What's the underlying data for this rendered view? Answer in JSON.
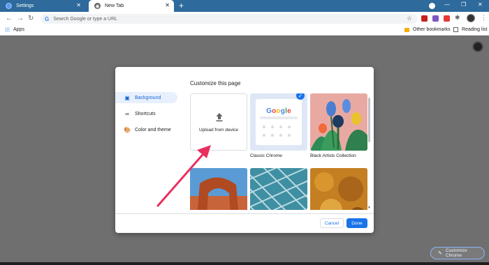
{
  "tabs": [
    {
      "label": "Settings",
      "icon": "gear-icon"
    },
    {
      "label": "New Tab",
      "icon": "chrome-icon"
    }
  ],
  "new_tab_button": "+",
  "window_controls": [
    "—",
    "❐",
    "✕"
  ],
  "omnibox": {
    "placeholder": "Search Google or type a URL",
    "icon": "G"
  },
  "bookmarks_bar": {
    "apps": "Apps",
    "other_bookmarks": "Other bookmarks",
    "reading_list": "Reading list"
  },
  "dialog": {
    "title": "Customize this page",
    "sidebar": [
      {
        "label": "Background",
        "icon": "image-icon",
        "active": true
      },
      {
        "label": "Shortcuts",
        "icon": "link-icon",
        "active": false
      },
      {
        "label": "Color and theme",
        "icon": "palette-icon",
        "active": false
      }
    ],
    "tiles": [
      {
        "label": "Upload from device"
      },
      {
        "label": "Classic Chrome",
        "logo": "Google",
        "selected": true
      },
      {
        "label": "Black Artists Collection"
      }
    ],
    "buttons": {
      "cancel": "Cancel",
      "done": "Done"
    }
  },
  "customize_chrome": "Customize Chrome",
  "colors": {
    "accent": "#1a73e8",
    "tabstrip": "#2e6a9b",
    "overlay": "#6f6f6f",
    "arrow": "#e8305f"
  }
}
